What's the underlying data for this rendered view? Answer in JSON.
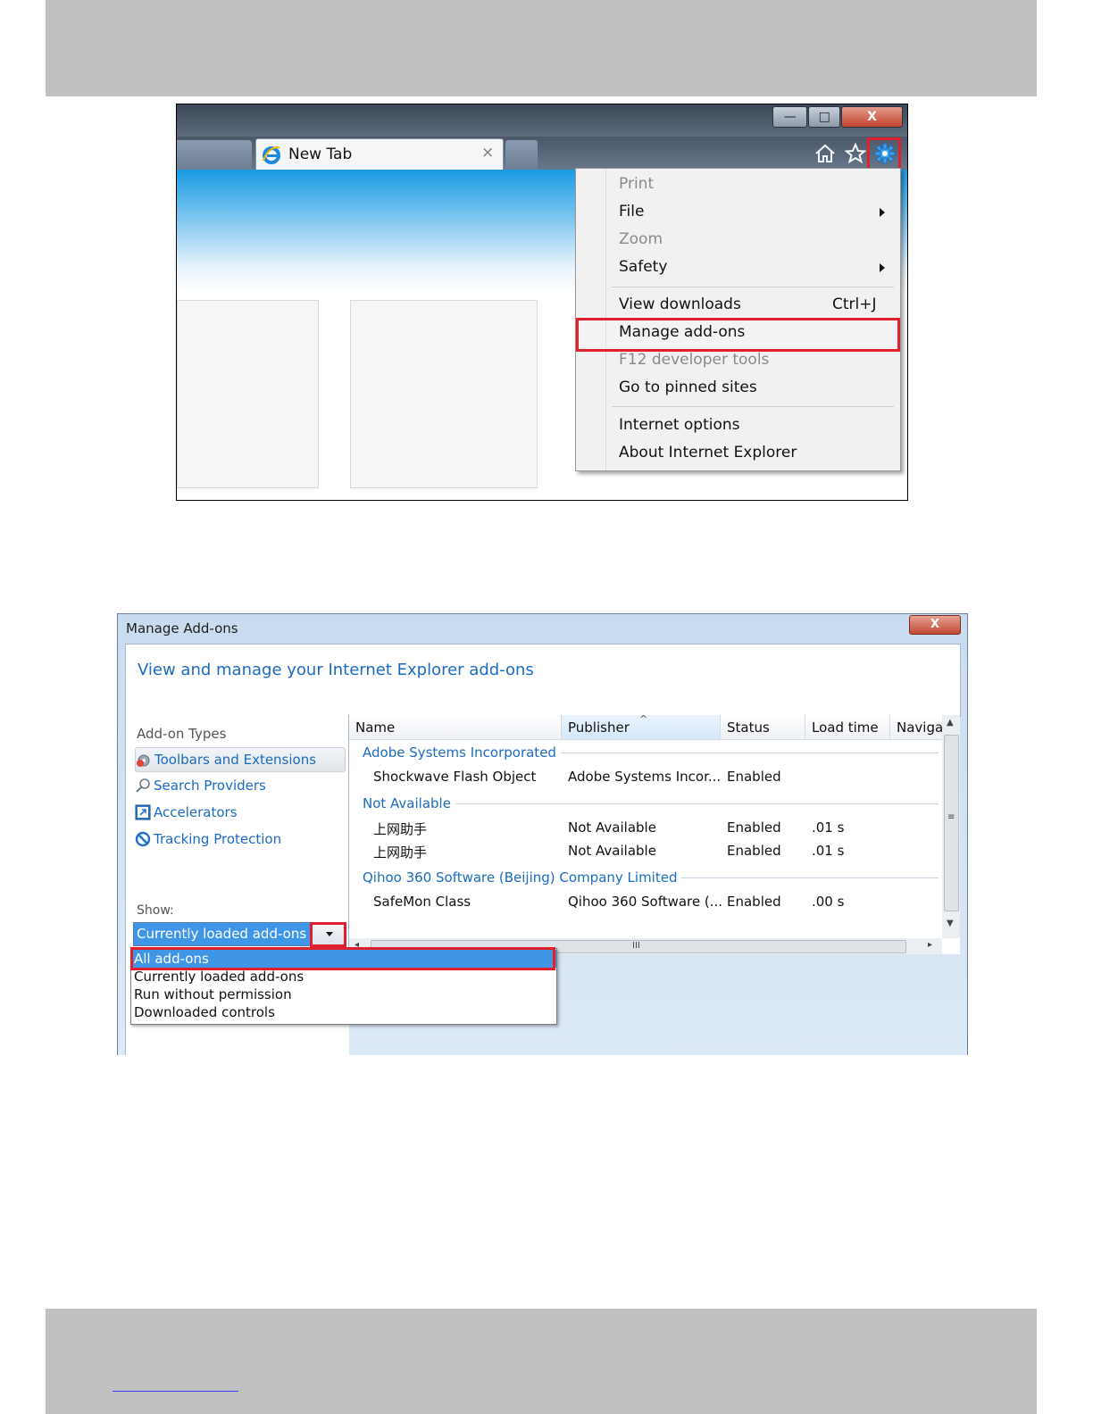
{
  "browser": {
    "tab_title": "New Tab",
    "tab_close_glyph": "×",
    "window_buttons": {
      "minimize": "—",
      "maximize": "□",
      "close": "X"
    },
    "icons": [
      "ie-logo-icon",
      "home-icon",
      "favorites-star-icon",
      "gear-icon"
    ],
    "highlight_color": "#e0202c",
    "tools_menu": {
      "items": [
        {
          "label": "Print",
          "enabled": false
        },
        {
          "label": "File",
          "submenu": true
        },
        {
          "label": "Zoom",
          "enabled": false
        },
        {
          "label": "Safety",
          "submenu": true
        },
        {
          "label": "View downloads",
          "shortcut": "Ctrl+J"
        },
        {
          "label": "Manage add-ons",
          "highlighted": true
        },
        {
          "label": "F12 developer tools",
          "enabled": false
        },
        {
          "label": "Go to pinned sites"
        },
        {
          "label": "Internet options"
        },
        {
          "label": "About Internet Explorer"
        }
      ]
    }
  },
  "manage_addons": {
    "window_title": "Manage Add-ons",
    "close_glyph": "X",
    "heading": "View and manage your Internet Explorer add-ons",
    "addon_types_label": "Add-on Types",
    "addon_types": [
      {
        "label": "Toolbars and Extensions",
        "selected": true
      },
      {
        "label": "Search Providers"
      },
      {
        "label": "Accelerators"
      },
      {
        "label": "Tracking Protection"
      }
    ],
    "show_label": "Show:",
    "show_value": "Currently loaded add-ons",
    "show_options": [
      "All add-ons",
      "Currently loaded add-ons",
      "Run without permission",
      "Downloaded controls"
    ],
    "columns": [
      "Name",
      "Publisher",
      "Status",
      "Load time",
      "Naviga"
    ],
    "groups": [
      {
        "name": "Adobe Systems Incorporated",
        "rows": [
          {
            "name": "Shockwave Flash Object",
            "publisher": "Adobe Systems Incor...",
            "status": "Enabled",
            "load_time": ""
          }
        ]
      },
      {
        "name": "Not Available",
        "rows": [
          {
            "name": "上网助手",
            "publisher": "Not Available",
            "status": "Enabled",
            "load_time": ".01 s"
          },
          {
            "name": "上网助手",
            "publisher": "Not Available",
            "status": "Enabled",
            "load_time": ".01 s"
          }
        ]
      },
      {
        "name": "Qihoo 360 Software (Beijing) Company Limited",
        "rows": [
          {
            "name": "SafeMon Class",
            "publisher": "Qihoo 360 Software (...",
            "status": "Enabled",
            "load_time": ".00 s"
          }
        ]
      }
    ],
    "scroll_glyphs": {
      "up": "▲",
      "down": "▼",
      "left": "◂",
      "right": "▸",
      "grip_v": "≡",
      "grip_h": "III"
    }
  }
}
